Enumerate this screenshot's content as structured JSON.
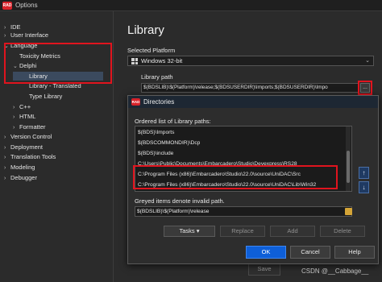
{
  "window": {
    "icon_text": "RAD",
    "title": "Options"
  },
  "tree": [
    {
      "label": "IDE",
      "chevron": ">"
    },
    {
      "label": "User Interface",
      "chevron": ">"
    },
    {
      "label": "Language",
      "chevron": "v"
    },
    {
      "label": "Toxicity Metrics",
      "chevron": ""
    },
    {
      "label": "Delphi",
      "chevron": "v"
    },
    {
      "label": "Library",
      "chevron": ""
    },
    {
      "label": "Library - Translated",
      "chevron": ""
    },
    {
      "label": "Type Library",
      "chevron": ""
    },
    {
      "label": "C++",
      "chevron": ">"
    },
    {
      "label": "HTML",
      "chevron": ">"
    },
    {
      "label": "Formatter",
      "chevron": ">"
    },
    {
      "label": "Version Control",
      "chevron": ">"
    },
    {
      "label": "Deployment",
      "chevron": ">"
    },
    {
      "label": "Translation Tools",
      "chevron": ">"
    },
    {
      "label": "Modeling",
      "chevron": ">"
    },
    {
      "label": "Debugger",
      "chevron": ">"
    }
  ],
  "page": {
    "title": "Library",
    "platform_label": "Selected Platform",
    "platform_value": "Windows 32-bit",
    "library_path_label": "Library path",
    "library_path_value": "$(BDSLIB)\\$(Platform)\\release;$(BDSUSERDIR)\\Imports;$(BDSUSERDIR)\\Impo",
    "browse_label": "...",
    "save_label": "Save"
  },
  "dialog": {
    "icon_text": "RAD",
    "title": "Directories",
    "list_label": "Ordered list of Library paths:",
    "paths": [
      "$(BDS)\\Imports",
      "$(BDSCOMMONDIR)\\Dcp",
      "$(BDS)\\include",
      "C:\\Users\\Public\\Documents\\Embarcadero\\Studio\\Devexpress\\RS28",
      "C:\\Program Files (x86)\\Embarcadero\\Studio\\22.0\\source\\UniDAC\\Src",
      "C:\\Program Files (x86)\\Embarcadero\\Studio\\22.0\\source\\UniDAC\\Lib\\Win32"
    ],
    "invalid_label": "Greyed items denote invalid path.",
    "new_path_value": "$(BDSLIB)\\$(Platform)\\release",
    "tasks_label": "Tasks",
    "replace_label": "Replace",
    "add_label": "Add",
    "delete_label": "Delete",
    "ok_label": "OK",
    "cancel_label": "Cancel",
    "help_label": "Help"
  },
  "watermark": "CSDN @__Cabbage__",
  "colors": {
    "highlight": "#e0141e",
    "accent": "#0e5fd8"
  }
}
